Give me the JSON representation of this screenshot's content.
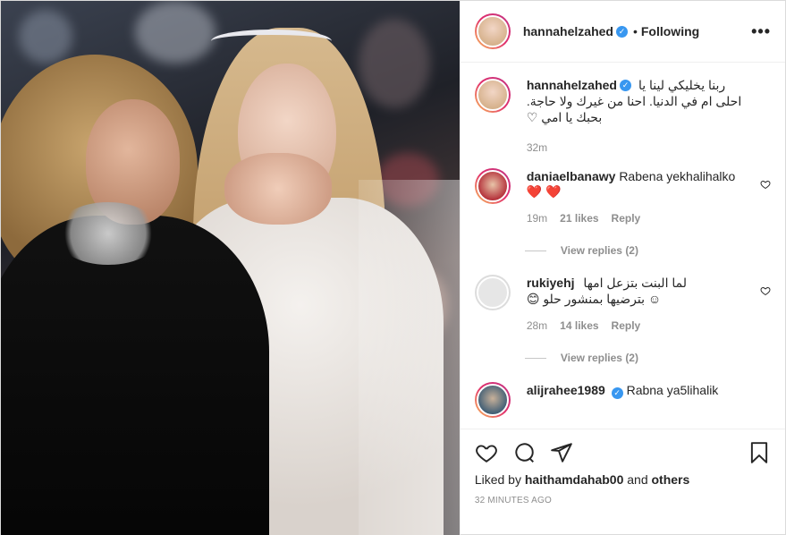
{
  "post": {
    "author": "hannahelzahed",
    "separator": "•",
    "follow_state": "Following",
    "more_label": "•••"
  },
  "caption": {
    "username": "hannahelzahed",
    "line1": "ربنا يخليكي لينا يا",
    "line2": "احلى ام في الدنيا. احنا من غيرك ولا حاجة.",
    "line3": "بحبك يا امي ♡",
    "time": "32m"
  },
  "comments": [
    {
      "username": "daniaelbanawy",
      "text": "Rabena yekhalihalko",
      "emoji": "❤️ ❤️",
      "time": "19m",
      "likes": "21 likes",
      "reply": "Reply",
      "view_replies": "View replies (2)"
    },
    {
      "username": "rukiyehj",
      "text_line1": "لما البنت بتزعل امها",
      "text_line2": "☺ بترضيها بمنشور حلو 😊",
      "time": "28m",
      "likes": "14 likes",
      "reply": "Reply",
      "view_replies": "View replies (2)"
    },
    {
      "username": "alijrahee1989",
      "text": "Rabna ya5lihalik"
    }
  ],
  "footer": {
    "liked_prefix": "Liked by",
    "liked_user": "haithamdahab00",
    "liked_and": "and",
    "liked_others": "others",
    "timestamp": "32 MINUTES AGO"
  },
  "icons": {
    "verified": "verified-badge-icon",
    "like": "heart-icon",
    "comment": "comment-icon",
    "share": "share-icon",
    "save": "bookmark-icon",
    "more": "more-options-icon"
  },
  "colors": {
    "verified": "#3897f0",
    "muted": "#8e8e8e",
    "text": "#262626",
    "heart": "#ed4956"
  }
}
